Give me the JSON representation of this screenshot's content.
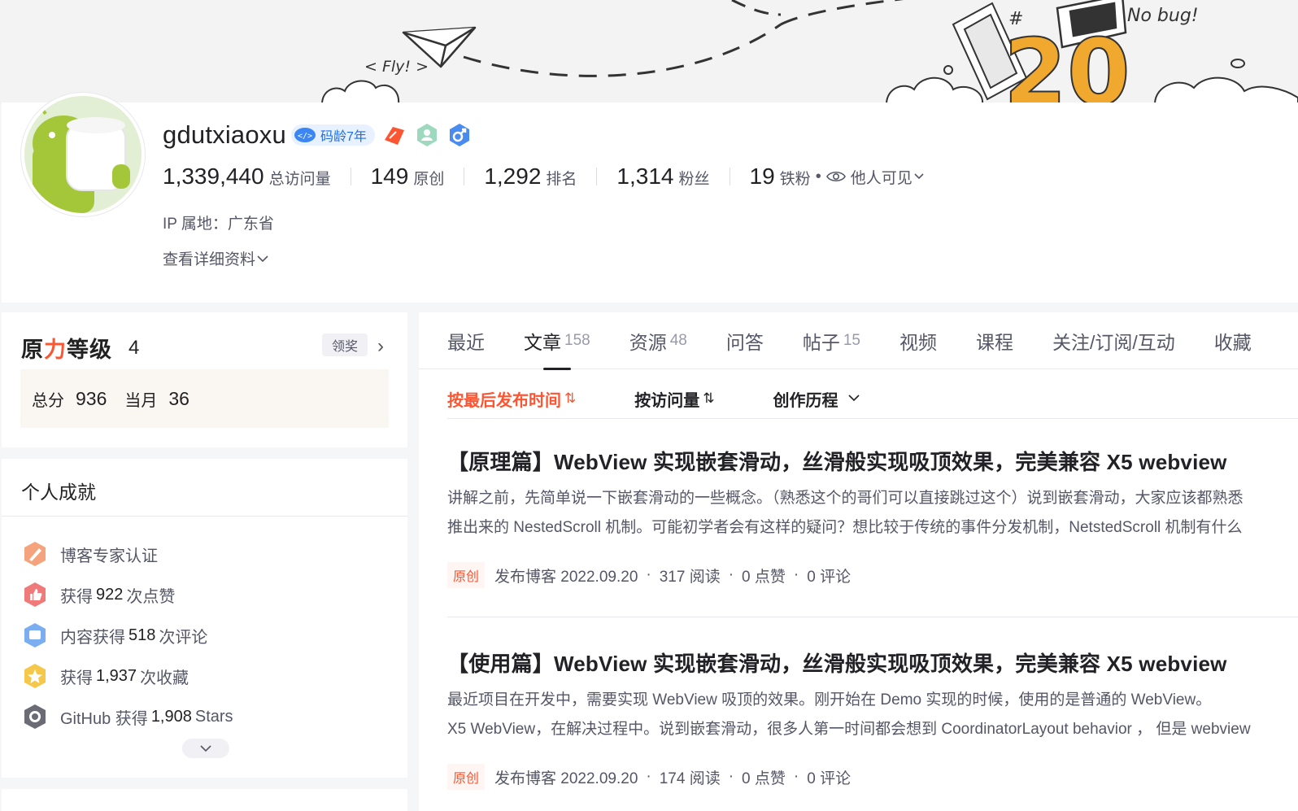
{
  "banner": {
    "fly_text": "< Fly! >",
    "nobug_text": "No bug!",
    "hash_text": "#",
    "number_text": "20"
  },
  "profile": {
    "username": "gdutxiaoxu",
    "code_age": "码龄7年",
    "stats": [
      {
        "value": "1,339,440",
        "label": "总访问量"
      },
      {
        "value": "149",
        "label": "原创"
      },
      {
        "value": "1,292",
        "label": "排名"
      },
      {
        "value": "1,314",
        "label": "粉丝"
      },
      {
        "value": "19",
        "label": "铁粉"
      }
    ],
    "visibility": "他人可见",
    "ip_location": "IP 属地：广东省",
    "detail_link": "查看详细资料"
  },
  "level": {
    "brand_pre": "原",
    "brand_red": "力",
    "brand_post": "等级",
    "value": "4",
    "claim": "领奖",
    "total_label": "总分",
    "total_value": "936",
    "month_label": "当月",
    "month_value": "36"
  },
  "achievements": {
    "title": "个人成就",
    "items": [
      {
        "pre": "博客专家认证",
        "num": "",
        "post": "",
        "icon": "expert-icon"
      },
      {
        "pre": "获得",
        "num": "922",
        "post": "次点赞",
        "icon": "like-icon"
      },
      {
        "pre": "内容获得",
        "num": "518",
        "post": "次评论",
        "icon": "comment-icon"
      },
      {
        "pre": "获得",
        "num": "1,937",
        "post": "次收藏",
        "icon": "star-icon"
      },
      {
        "pre": "GitHub 获得",
        "num": "1,908",
        "post": "Stars",
        "icon": "github-icon"
      }
    ]
  },
  "tabs": [
    {
      "label": "最近",
      "count": ""
    },
    {
      "label": "文章",
      "count": "158"
    },
    {
      "label": "资源",
      "count": "48"
    },
    {
      "label": "问答",
      "count": ""
    },
    {
      "label": "帖子",
      "count": "15"
    },
    {
      "label": "视频",
      "count": ""
    },
    {
      "label": "课程",
      "count": ""
    },
    {
      "label": "关注/订阅/互动",
      "count": ""
    },
    {
      "label": "收藏",
      "count": ""
    }
  ],
  "sort": {
    "by_time": "按最后发布时间",
    "by_views": "按访问量",
    "history": "创作历程"
  },
  "articles": [
    {
      "title": "【原理篇】WebView 实现嵌套滑动，丝滑般实现吸顶效果，完美兼容 X5 webview",
      "desc1": "讲解之前，先简单说一下嵌套滑动的一些概念。（熟悉这个的哥们可以直接跳过这个）说到嵌套滑动，大家应该都熟悉",
      "desc2": "推出来的 NestedScroll 机制。可能初学者会有这样的疑问？想比较于传统的事件分发机制，NetstedScroll 机制有什么",
      "tag": "原创",
      "published": "发布博客 2022.09.20",
      "reads": "317 阅读",
      "likes": "0 点赞",
      "comments": "0 评论"
    },
    {
      "title": "【使用篇】WebView 实现嵌套滑动，丝滑般实现吸顶效果，完美兼容 X5 webview",
      "desc1": "最近项目在开发中，需要实现 WebView 吸顶的效果。刚开始在 Demo 实现的时候，使用的是普通的 WebView。",
      "desc2": "X5 WebView，在解决过程中。说到嵌套滑动，很多人第一时间都会想到 CoordinatorLayout behavior ， 但是 webview",
      "tag": "原创",
      "published": "发布博客 2022.09.20",
      "reads": "174 阅读",
      "likes": "0 点赞",
      "comments": "0 评论"
    }
  ],
  "colors": {
    "accent": "#fc5531",
    "code_age_blue": "#1f6fe5",
    "text_primary": "#222226",
    "text_secondary": "#555666"
  }
}
